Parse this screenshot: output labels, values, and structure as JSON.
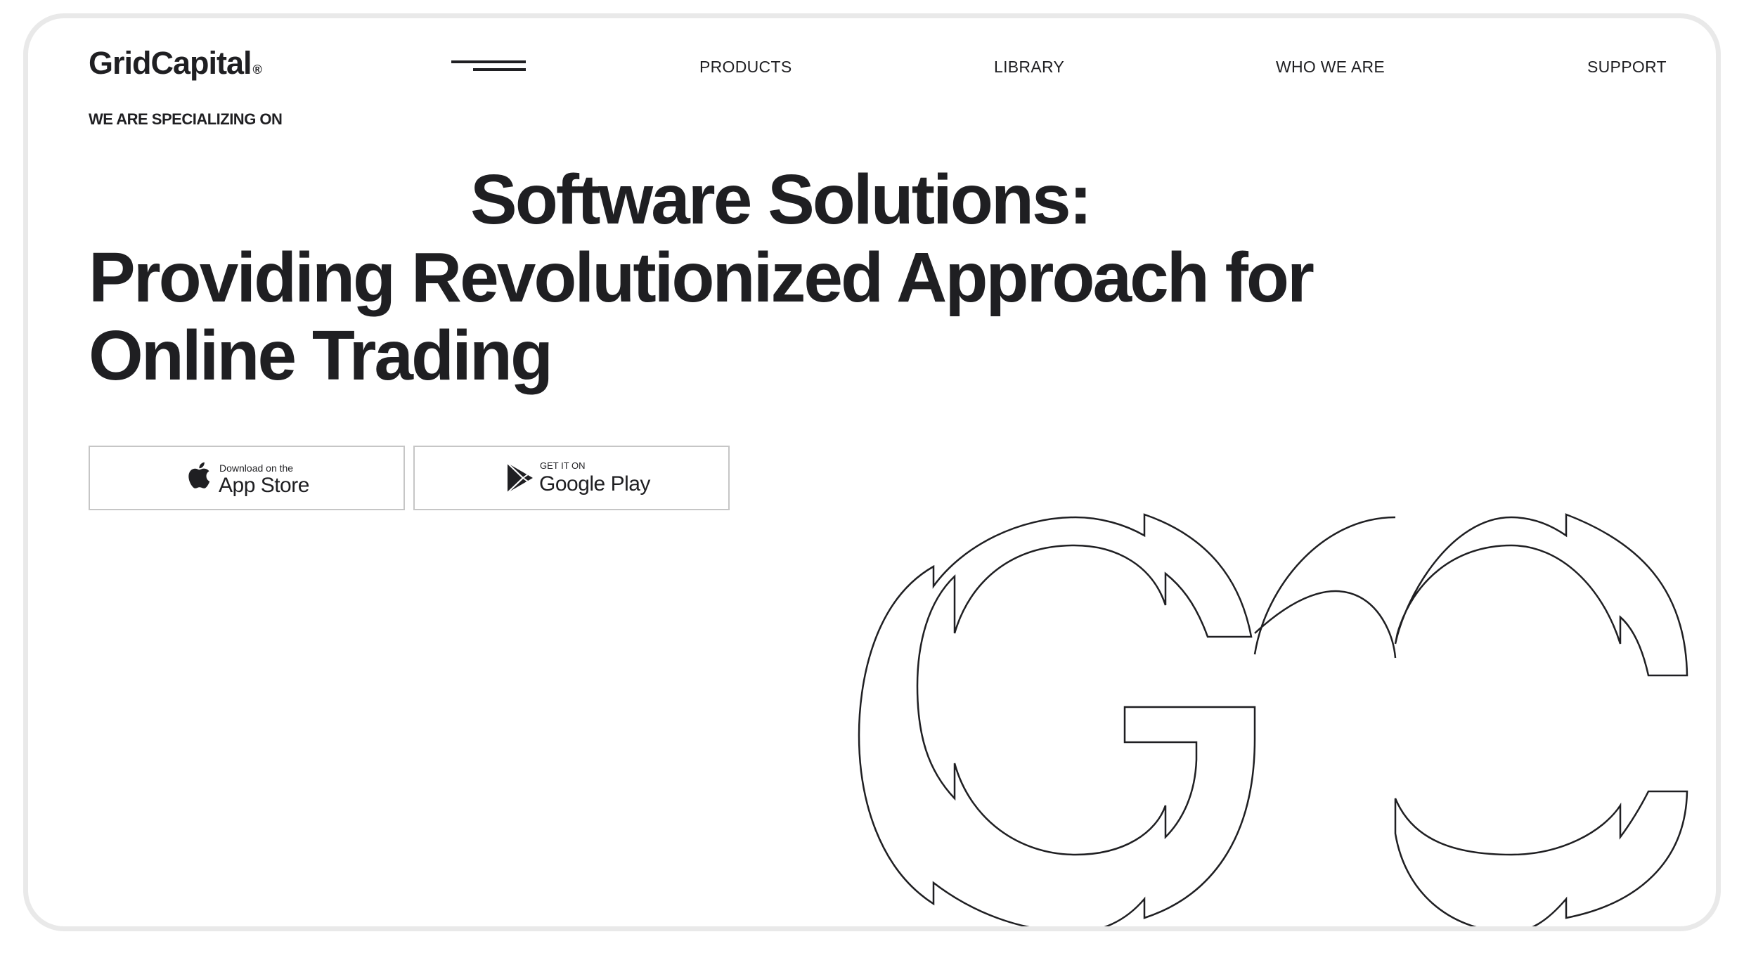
{
  "brand": {
    "name": "GridCapital",
    "registered_mark": "®"
  },
  "nav": {
    "menu_icon": "hamburger-menu-icon",
    "items": [
      {
        "label": "PRODUCTS"
      },
      {
        "label": "LIBRARY"
      },
      {
        "label": "WHO WE ARE"
      },
      {
        "label": "SUPPORT"
      }
    ]
  },
  "hero": {
    "tagline": "WE ARE SPECIALIZING ON",
    "headline_line1": "Software Solutions:",
    "headline_line2": "Providing Revolutionized Approach for",
    "headline_line3": "Online Trading"
  },
  "downloads": {
    "app_store": {
      "icon": "apple-icon",
      "small_text": "Download on the",
      "big_text": "App Store"
    },
    "google_play": {
      "icon": "google-play-icon",
      "small_text": "GET IT ON",
      "big_text": "Google Play"
    }
  },
  "decoration": {
    "monogram": "GC",
    "style": "outline"
  },
  "colors": {
    "text": "#1f1f22",
    "border": "#c6c6c6",
    "frame": "#e9e9e9",
    "background": "#ffffff"
  }
}
